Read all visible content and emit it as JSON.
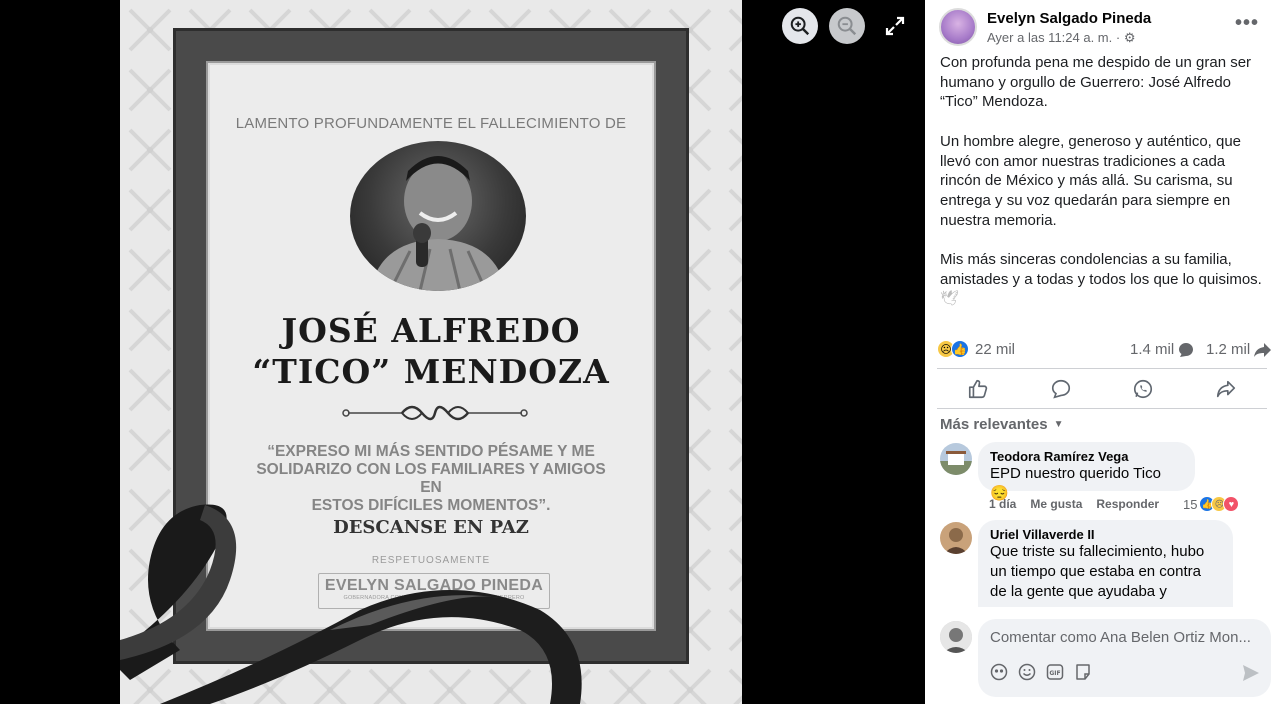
{
  "viewer": {
    "zoom_in_icon": "zoom-in-icon",
    "zoom_out_icon": "zoom-out-icon",
    "expand_icon": "expand-icon"
  },
  "poster": {
    "lament": "LAMENTO PROFUNDAMENTE EL FALLECIMIENTO DE",
    "name_line1": "JOSÉ  ALFREDO",
    "name_line2": "“TICO” MENDOZA",
    "quote_lines": [
      "“EXPRESO MI MÁS SENTIDO PÉSAME Y ME",
      "SOLIDARIZO CON LOS FAMILIARES Y AMIGOS EN",
      "ESTOS DIFÍCILES MOMENTOS”."
    ],
    "rest": "DESCANSE EN PAZ",
    "respectfully": "RESPETUOSAMENTE",
    "signature": "EVELYN SALGADO PINEDA",
    "signature_sub": "GOBERNADORA CONSTITUCIONAL DEL ESTADO DE GUERRERO"
  },
  "post": {
    "author": "Evelyn Salgado Pineda",
    "time": "Ayer a las 11:24 a. m. ·",
    "paragraphs": [
      "Con profunda pena me despido de un gran ser humano y orgullo de Guerrero: José Alfredo “Tico” Mendoza.",
      "Un hombre alegre, generoso y auténtico, que llevó con amor nuestras tradiciones a cada rincón de México y más allá. Su carisma, su entrega y su voz quedarán para siempre en nuestra memoria.",
      "Mis más sinceras condolencias a su familia, amistades y a todas y todos los que lo quisimos."
    ],
    "reactions_count": "22 mil",
    "comments_count": "1.4 mil",
    "shares_count": "1.2 mil"
  },
  "actions": [
    "like-icon",
    "comment-icon",
    "whatsapp-icon",
    "share-icon"
  ],
  "filter": "Más relevantes",
  "comments": [
    {
      "name": "Teodora Ramírez Vega",
      "text": "EPD nuestro querido Tico 😔",
      "age": "1 día",
      "like": "Me gusta",
      "reply": "Responder",
      "reactions": "15"
    },
    {
      "name": "Uriel Villaverde II",
      "text": "Que triste su fallecimiento, hubo un tiempo que estaba en contra de la gente que ayudaba y"
    }
  ],
  "composer": {
    "placeholder": "Comentar como Ana Belen Ortiz Mon..."
  },
  "colors": {
    "accent": "#1b74e4",
    "muted": "#65676b",
    "bubble": "#f0f2f5"
  }
}
